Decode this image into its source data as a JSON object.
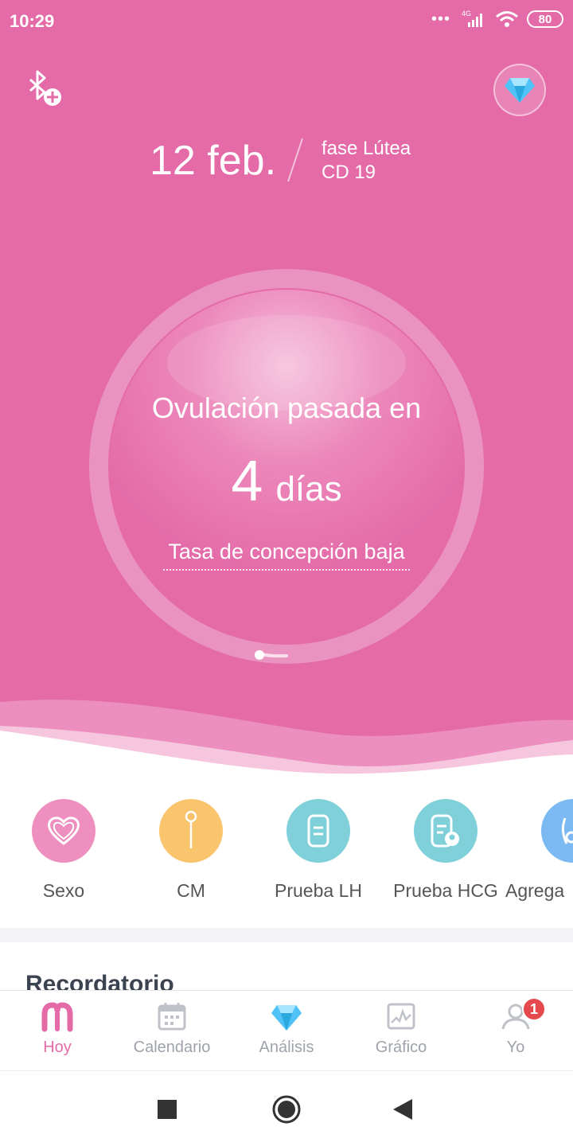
{
  "status_bar": {
    "time": "10:29",
    "dots": "•••",
    "network": "4G",
    "battery": "80"
  },
  "header": {
    "date": "12 feb.",
    "phase": "fase Lútea",
    "cycle_day": "CD 19"
  },
  "ring": {
    "title": "Ovulación pasada en",
    "days_number": "4",
    "days_word": "días",
    "conception": "Tasa de concepción baja"
  },
  "quick_actions": [
    {
      "label": "Sexo",
      "color": "#ee8fbf",
      "icon": "heart-icon"
    },
    {
      "label": "CM",
      "color": "#f9c46b",
      "icon": "drop-icon"
    },
    {
      "label": "Prueba LH",
      "color": "#7fd0d9",
      "icon": "test-strip-icon"
    },
    {
      "label": "Prueba HCG",
      "color": "#7fd0d9",
      "icon": "pregnancy-test-icon"
    },
    {
      "label": "Agrega",
      "color": "#7cb8f2",
      "icon": "add-icon"
    }
  ],
  "section": {
    "title": "Recordatorio"
  },
  "bottom_nav": [
    {
      "label": "Hoy",
      "icon": "home-icon",
      "active": true
    },
    {
      "label": "Calendario",
      "icon": "calendar-icon",
      "active": false
    },
    {
      "label": "Análisis",
      "icon": "diamond-icon",
      "active": false
    },
    {
      "label": "Gráfico",
      "icon": "chart-icon",
      "active": false
    },
    {
      "label": "Yo",
      "icon": "user-icon",
      "active": false,
      "badge": "1"
    }
  ],
  "colors": {
    "accent": "#e46aa8",
    "badge": "#e5484d",
    "nav_inactive": "#9ea3ab"
  }
}
